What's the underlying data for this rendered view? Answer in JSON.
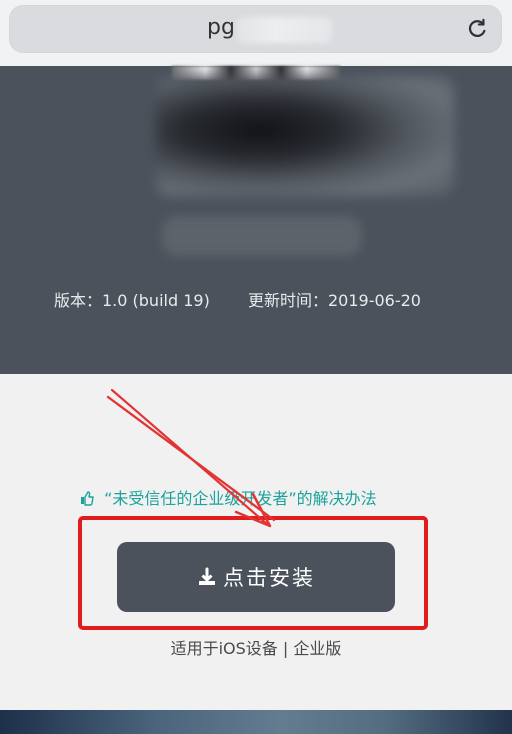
{
  "browser": {
    "url_visible": "pg"
  },
  "app": {
    "version_label": "版本：1.0 (build 19)",
    "updated_label": "更新时间：2019-06-20"
  },
  "install_page": {
    "trust_hint": "“未受信任的企业级开发者”的解决办法",
    "install_button_label": "点击安装",
    "device_label": "适用于iOS设备 | 企业版"
  },
  "colors": {
    "panel_bg": "#4b525c",
    "button_bg": "#4b525c",
    "link_green": "#1ba39a",
    "highlight_red": "#e11c1c"
  },
  "icons": {
    "reload": "reload-icon",
    "thumb": "thumbs-up-icon",
    "download": "download-icon"
  }
}
